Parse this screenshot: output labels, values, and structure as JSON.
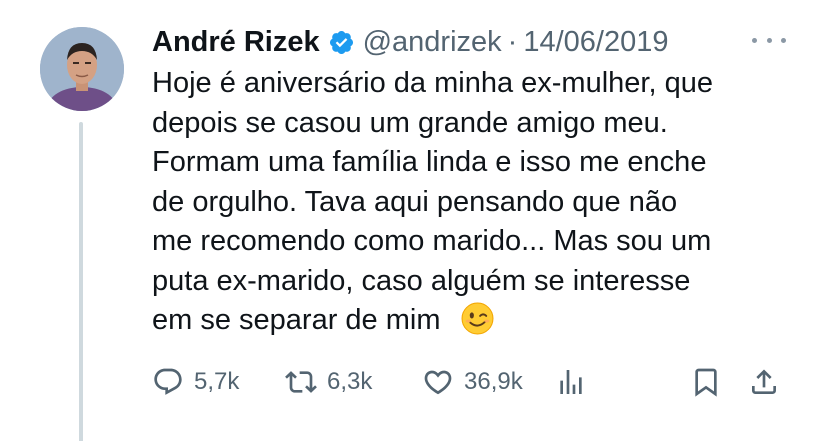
{
  "author": {
    "name": "André Rizek",
    "handle": "@andrizek",
    "separator": "·",
    "date": "14/06/2019",
    "verified": true
  },
  "tweet": {
    "lines": [
      "Hoje é aniversário da minha ex-mulher, que",
      "depois se casou um grande amigo meu.",
      "Formam uma família linda e isso me enche",
      "de orgulho. Tava aqui pensando que não",
      "me recomendo como marido... Mas sou um",
      "puta ex-marido, caso alguém se interesse",
      "em se separar de mim"
    ],
    "emoji": "winking-face"
  },
  "actions": {
    "replies": "5,7k",
    "retweets": "6,3k",
    "likes": "36,9k"
  },
  "icons": {
    "reply": "reply-icon",
    "retweet": "retweet-icon",
    "like": "heart-icon",
    "views": "views-icon",
    "bookmark": "bookmark-icon",
    "share": "share-icon",
    "more": "more-icon",
    "verified": "verified-badge-icon"
  },
  "colors": {
    "text": "#0f1419",
    "secondary": "#536471",
    "verified": "#1d9bf0",
    "thread_line": "#cfd9de"
  }
}
